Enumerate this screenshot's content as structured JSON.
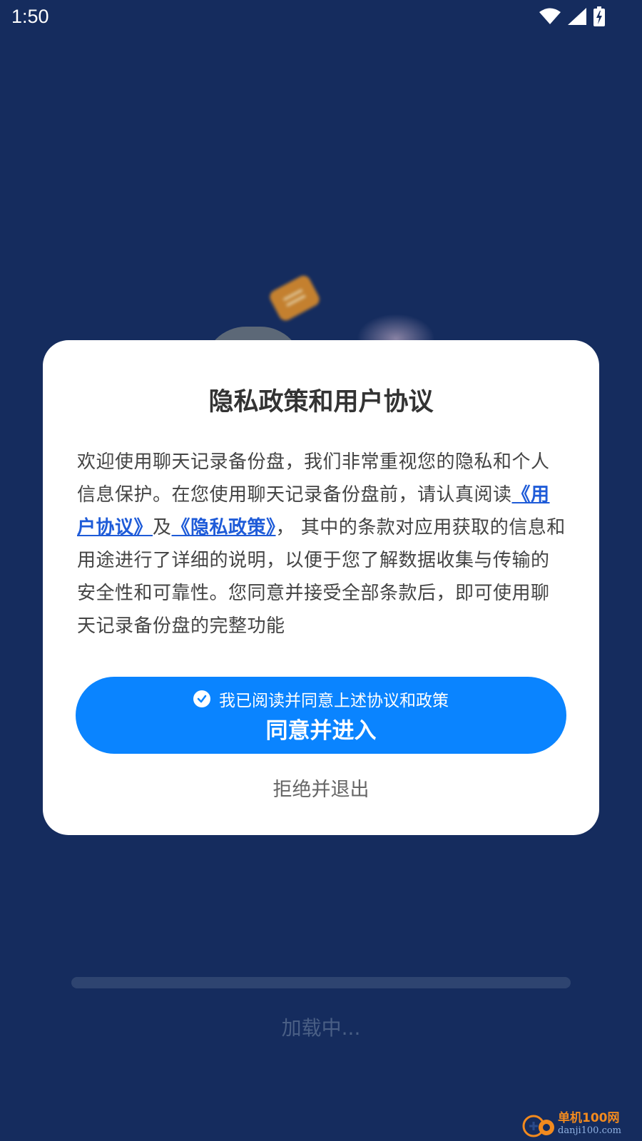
{
  "status_bar": {
    "time": "1:50",
    "icons": [
      "wifi-icon",
      "signal-icon",
      "battery-charging-icon"
    ]
  },
  "dialog": {
    "title": "隐私政策和用户协议",
    "body": {
      "intro": "欢迎使用聊天记录备份盘，我们非常重视您的隐私和个人信息保护。在您使用聊天记录备份盘前，请认真阅读",
      "user_agreement_link": "《用户协议》",
      "and": "及",
      "privacy_policy_link": "《隐私政策》",
      "rest": "， 其中的条款对应用获取的信息和用途进行了详细的说明，以便于您了解数据收集与传输的安全性和可靠性。您同意并接受全部条款后，即可使用聊天记录备份盘的完整功能"
    },
    "agree_button": {
      "check_text": "我已阅读并同意上述协议和政策",
      "checked": true,
      "label": "同意并进入"
    },
    "reject_button": "拒绝并退出"
  },
  "loading": {
    "progress": 0,
    "text": "加载中..."
  },
  "watermark": {
    "name": "单机100网",
    "url": "danji100.com"
  },
  "colors": {
    "background": "#152c5e",
    "accent": "#0a84ff",
    "link": "#1e5bd8",
    "dialog": "#ffffff"
  }
}
